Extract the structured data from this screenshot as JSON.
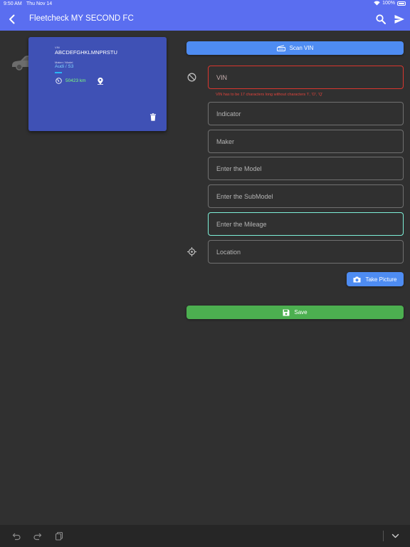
{
  "status_bar": {
    "time": "9:50 AM",
    "date": "Thu Nov 14",
    "battery": "100%"
  },
  "app_bar": {
    "title": "Fleetcheck MY SECOND FC"
  },
  "vehicle_card": {
    "vin_label": "VIN",
    "vin": "ABCDEFGHKLMNPRSTU",
    "maker_model_label": "Maker / Model",
    "maker_model": "Audi / S3",
    "mileage": "50423 km"
  },
  "form": {
    "scan_vin_label": "Scan VIN",
    "vin_placeholder": "VIN",
    "vin_error": "VIN has to be 17 characters long without characters 'I', 'O', 'Q'",
    "indicator_placeholder": "Indicator",
    "maker_placeholder": "Maker",
    "model_placeholder": "Enter the Model",
    "submodel_placeholder": "Enter the SubModel",
    "mileage_placeholder": "Enter the Mileage",
    "location_placeholder": "Location",
    "take_picture_label": "Take Picture",
    "save_label": "Save"
  },
  "colors": {
    "app_bar": "#5a6ef0",
    "card": "#3f51b5",
    "primary_button": "#4e8cf2",
    "save_button": "#4caf50",
    "error": "#d9362e",
    "focus": "#7ef0d8"
  },
  "icons": [
    "back-arrow-icon",
    "search-icon",
    "send-icon",
    "car-icon",
    "speedometer-icon",
    "map-pin-icon",
    "trash-icon",
    "scanner-icon",
    "block-icon",
    "gps-target-icon",
    "camera-icon",
    "floppy-disk-icon",
    "undo-icon",
    "redo-icon",
    "clipboard-icon",
    "chevron-down-icon"
  ]
}
